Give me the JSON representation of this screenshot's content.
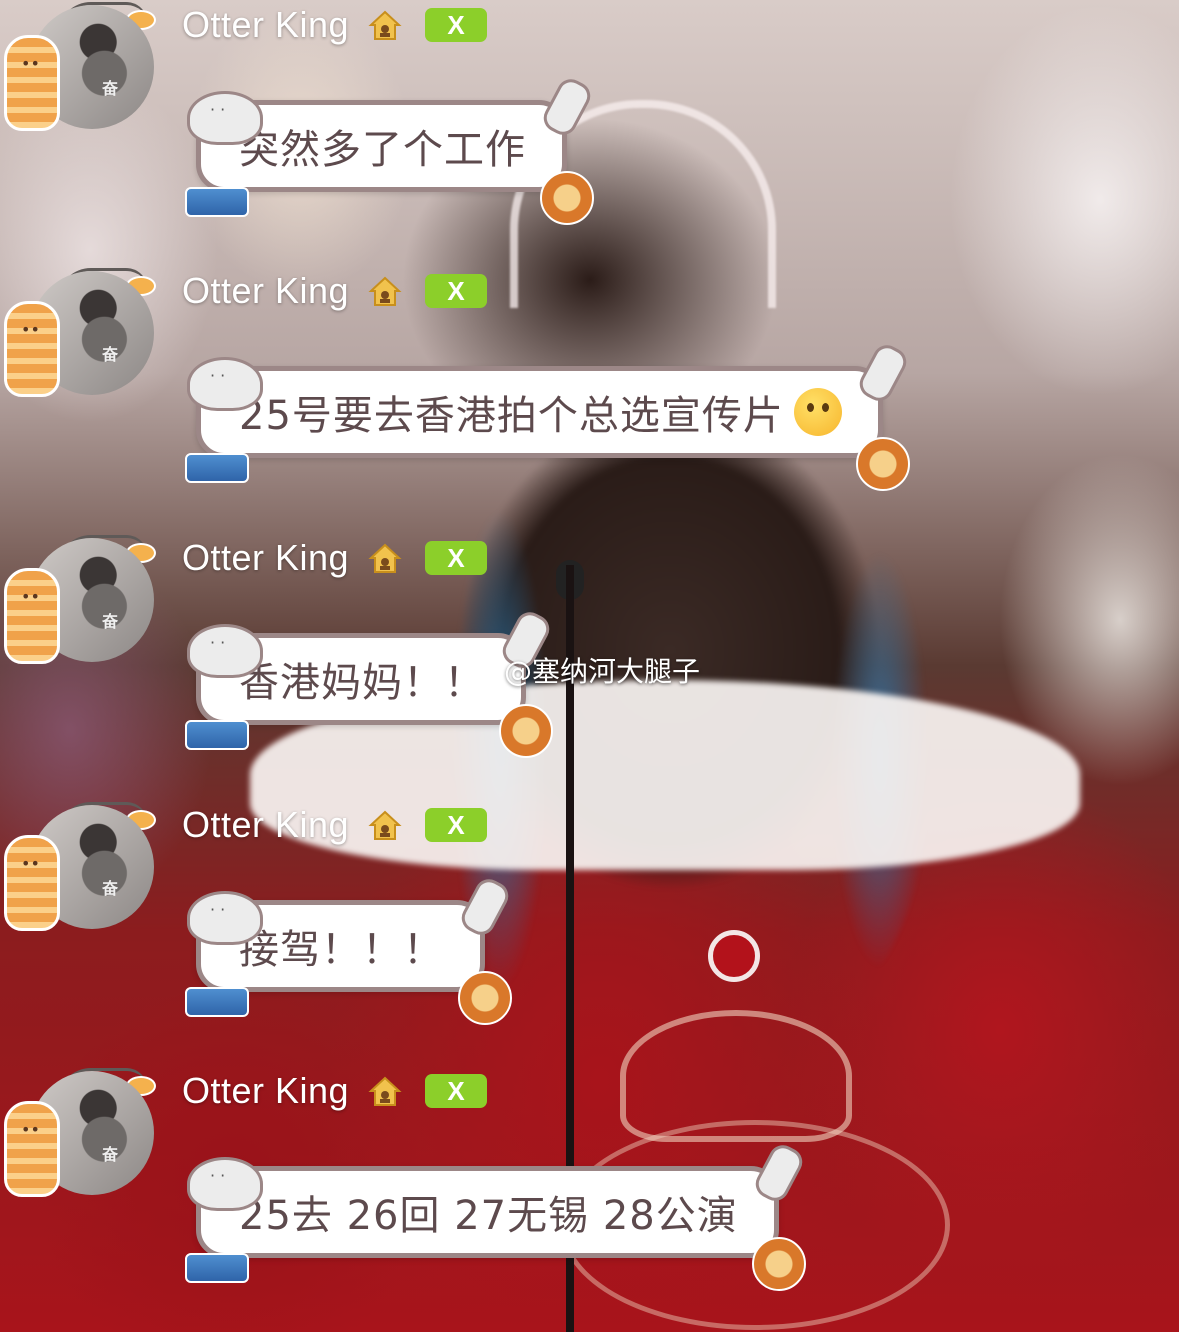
{
  "messages": [
    {
      "username": "Otter King",
      "badge": "X",
      "text": "突然多了个工作",
      "emoji": ""
    },
    {
      "username": "Otter King",
      "badge": "X",
      "text": "25号要去香港拍个总选宣传片",
      "emoji": "thinking-face"
    },
    {
      "username": "Otter King",
      "badge": "X",
      "text": "香港妈妈！！",
      "emoji": ""
    },
    {
      "username": "Otter King",
      "badge": "X",
      "text": "接驾！！！",
      "emoji": ""
    },
    {
      "username": "Otter King",
      "badge": "X",
      "text": "25去 26回 27无锡 28公演",
      "emoji": ""
    }
  ],
  "avatar": {
    "text": "奋"
  },
  "watermark": {
    "text": "@塞纳河大腿子",
    "icon": "weibo-icon"
  },
  "colors": {
    "badge": "#8ccf2a",
    "bubble_border": "#9c8787",
    "bubble_text": "#5d4a4d",
    "username": "#ffffff"
  }
}
